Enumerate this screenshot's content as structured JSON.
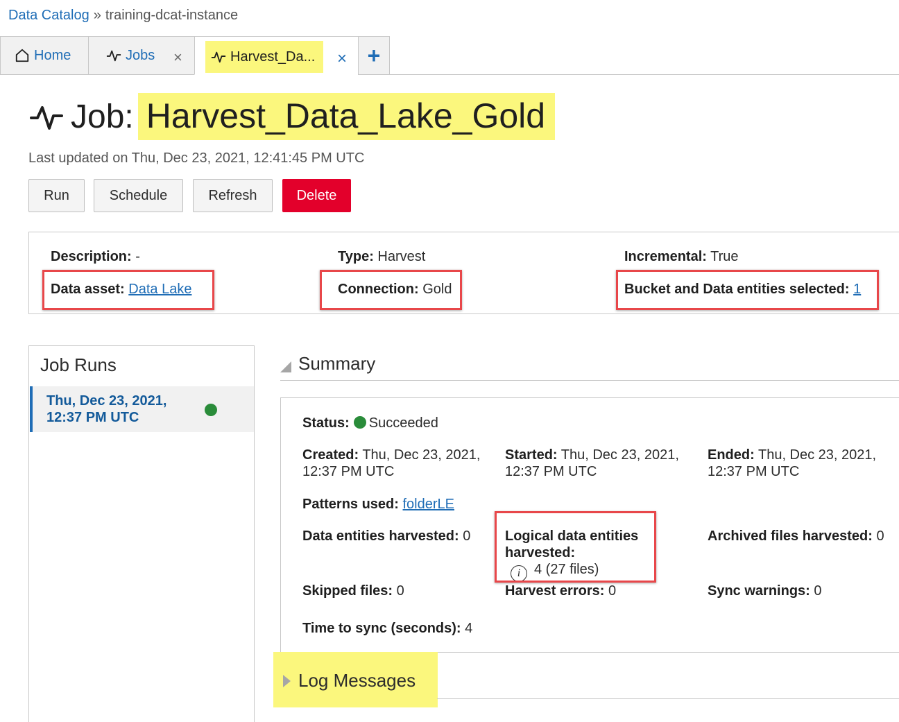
{
  "breadcrumb": {
    "root": "Data Catalog",
    "separator": "»",
    "current": "training-dcat-instance"
  },
  "tabs": [
    {
      "label": "Home",
      "icon": "home-icon",
      "closable": false
    },
    {
      "label": "Jobs",
      "icon": "activity-icon",
      "closable": true,
      "close": "×"
    },
    {
      "label": "Harvest_Da...",
      "icon": "activity-icon",
      "closable": true,
      "close": "×",
      "active": true
    }
  ],
  "add_tab": "+",
  "job": {
    "prefix": "Job:",
    "name": "Harvest_Data_Lake_Gold",
    "last_updated": "Last updated on Thu, Dec 23, 2021, 12:41:45 PM UTC"
  },
  "actions": {
    "run": "Run",
    "schedule": "Schedule",
    "refresh": "Refresh",
    "delete": "Delete"
  },
  "details": {
    "description": {
      "label": "Description:",
      "value": "-"
    },
    "data_asset": {
      "label": "Data asset:",
      "value": "Data Lake"
    },
    "type": {
      "label": "Type:",
      "value": "Harvest"
    },
    "connection": {
      "label": "Connection:",
      "value": "Gold"
    },
    "incremental": {
      "label": "Incremental:",
      "value": "True"
    },
    "bucket": {
      "label": "Bucket and Data entities selected:",
      "value": "1"
    }
  },
  "job_runs": {
    "title": "Job Runs",
    "items": [
      {
        "line1": "Thu, Dec 23, 2021,",
        "line2": "12:37 PM UTC",
        "status": "succeeded"
      }
    ]
  },
  "summary": {
    "title": "Summary",
    "status": {
      "label": "Status:",
      "value": "Succeeded"
    },
    "created": {
      "label": "Created:",
      "value1": "Thu, Dec 23, 2021,",
      "value2": "12:37 PM UTC"
    },
    "started": {
      "label": "Started:",
      "value1": "Thu, Dec 23, 2021,",
      "value2": "12:37 PM UTC"
    },
    "ended": {
      "label": "Ended:",
      "value1": "Thu, Dec 23, 2021,",
      "value2": "12:37 PM UTC"
    },
    "patterns": {
      "label": "Patterns used:",
      "value": "folderLE"
    },
    "data_entities": {
      "label": "Data entities harvested:",
      "value": "0"
    },
    "logical_entities": {
      "label1": "Logical data entities",
      "label2": "harvested:",
      "value": "4 (27 files)"
    },
    "archived_files": {
      "label": "Archived files harvested:",
      "value": "0"
    },
    "skipped_files": {
      "label": "Skipped files:",
      "value": "0"
    },
    "harvest_errors": {
      "label": "Harvest errors:",
      "value": "0"
    },
    "sync_warnings": {
      "label": "Sync warnings:",
      "value": "0"
    },
    "time_to_sync": {
      "label": "Time to sync (seconds):",
      "value": "4"
    }
  },
  "log_messages": {
    "title": "Log Messages"
  },
  "colors": {
    "accent": "#1f6db6",
    "delete": "#e3002b",
    "success": "#2a8c3a",
    "highlight": "#fbf77d",
    "annotation": "#e8474a"
  }
}
